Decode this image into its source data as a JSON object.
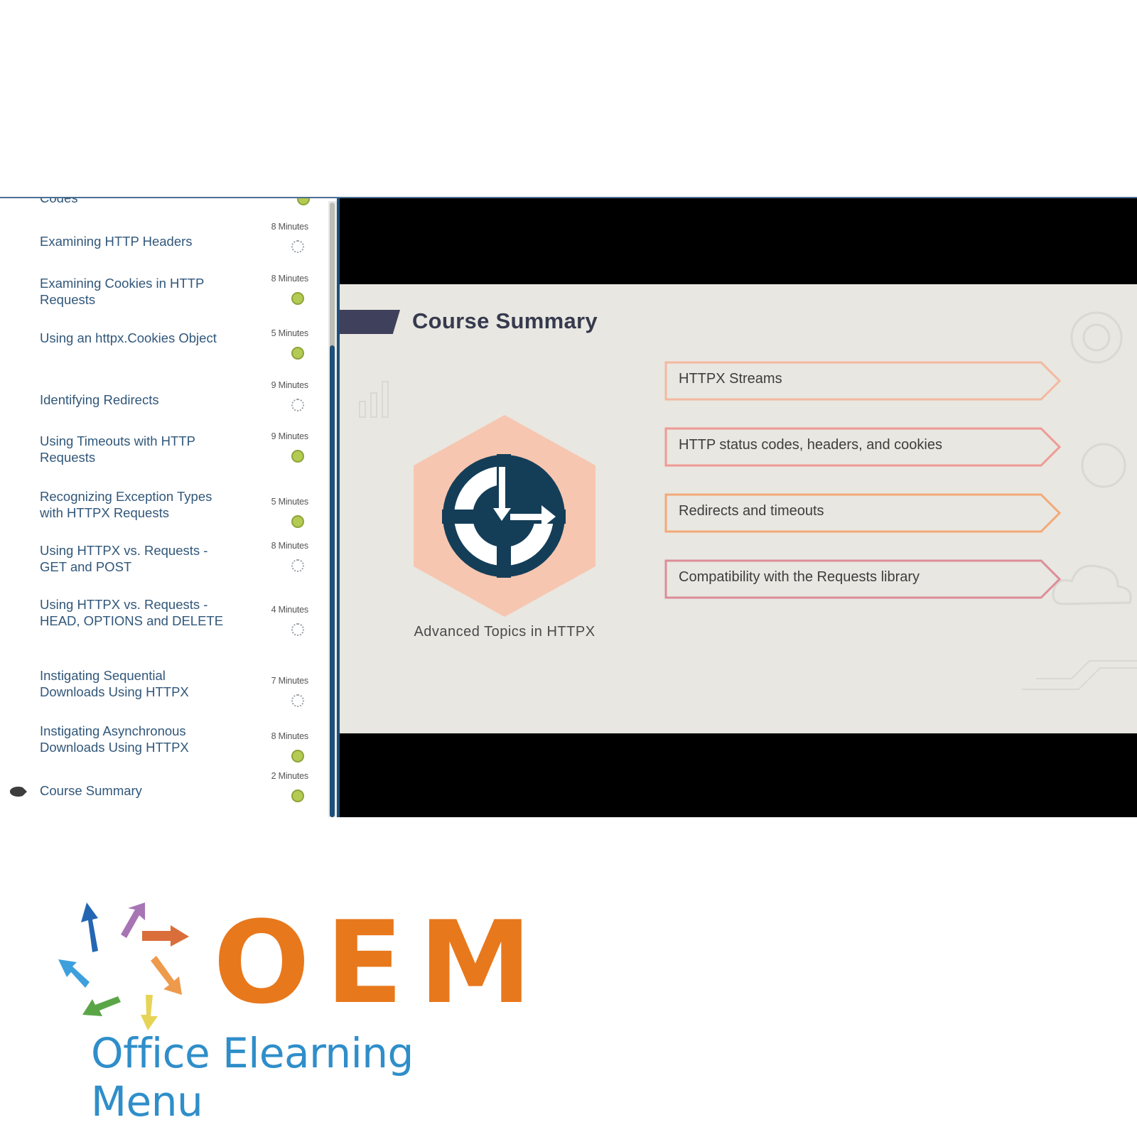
{
  "sidebar": {
    "partial_top_item": {
      "title": "Codes",
      "status": "completed"
    },
    "items": [
      {
        "title": "Examining HTTP Headers",
        "duration": "8 Minutes",
        "status": "not-started"
      },
      {
        "title": "Examining Cookies in HTTP Requests",
        "duration": "8 Minutes",
        "status": "completed"
      },
      {
        "title": "Using an httpx.Cookies Object",
        "duration": "5 Minutes",
        "status": "completed"
      },
      {
        "title": "Identifying Redirects",
        "duration": "9 Minutes",
        "status": "not-started"
      },
      {
        "title": "Using Timeouts with HTTP Requests",
        "duration": "9 Minutes",
        "status": "completed"
      },
      {
        "title": "Recognizing Exception Types with HTTPX Requests",
        "duration": "5 Minutes",
        "status": "completed"
      },
      {
        "title": "Using HTTPX vs. Requests - GET and POST",
        "duration": "8 Minutes",
        "status": "not-started"
      },
      {
        "title": "Using HTTPX vs. Requests - HEAD, OPTIONS and DELETE",
        "duration": "4 Minutes",
        "status": "not-started"
      },
      {
        "title": "Instigating Sequential Downloads Using HTTPX",
        "duration": "7 Minutes",
        "status": "not-started"
      },
      {
        "title": "Instigating Asynchronous Downloads Using HTTPX",
        "duration": "8 Minutes",
        "status": "completed"
      },
      {
        "title": "Course Summary",
        "duration": "2 Minutes",
        "status": "completed",
        "current": true
      }
    ]
  },
  "slide": {
    "title": "Course Summary",
    "course_caption": "Advanced Topics in HTTPX",
    "points": [
      {
        "text": "HTTPX Streams",
        "color": "#f4b8a0"
      },
      {
        "text": "HTTP status codes, headers, and cookies",
        "color": "#ef9a94"
      },
      {
        "text": "Redirects and timeouts",
        "color": "#f3a978"
      },
      {
        "text": "Compatibility with the Requests library",
        "color": "#dd8d98"
      }
    ]
  },
  "logo": {
    "brand": "OEM",
    "tagline": "Office Elearning Menu",
    "colors": {
      "brand": "#e8781c",
      "tagline": "#2f8ec9"
    }
  }
}
